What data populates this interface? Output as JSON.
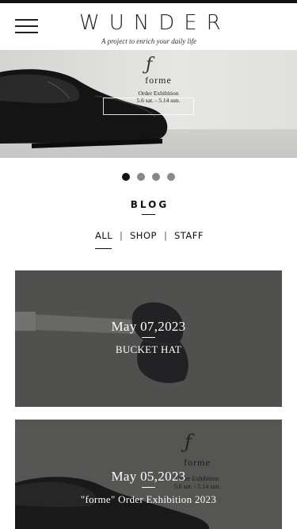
{
  "header": {
    "logo": "WUNDER",
    "tagline": "A project to enrich your daily life",
    "menu_icon": "hamburger-menu-icon"
  },
  "hero": {
    "brand": "forme",
    "event": "Order Exhibition",
    "dates": "5.6 sat. - 5.14 sun.",
    "slides_count": 4,
    "active_slide": 1
  },
  "blog": {
    "title": "BLOG",
    "filters": [
      "ALL",
      "SHOP",
      "STAFF"
    ],
    "separator": "|",
    "active_filter": "ALL",
    "posts": [
      {
        "date": "May 07,2023",
        "title": "BUCKET HAT"
      },
      {
        "date": "May 05,2023",
        "title": "\"forme\" Order Exhibition 2023",
        "image_text": {
          "brand": "forme",
          "event": "Order Exhibition",
          "dates": "5.6 sat. - 5.14 sun."
        }
      }
    ]
  },
  "colors": {
    "text": "#111111",
    "background": "#ffffff",
    "dot_active": "#111111",
    "dot_inactive": "#888888",
    "overlay_text": "#ffffff"
  }
}
